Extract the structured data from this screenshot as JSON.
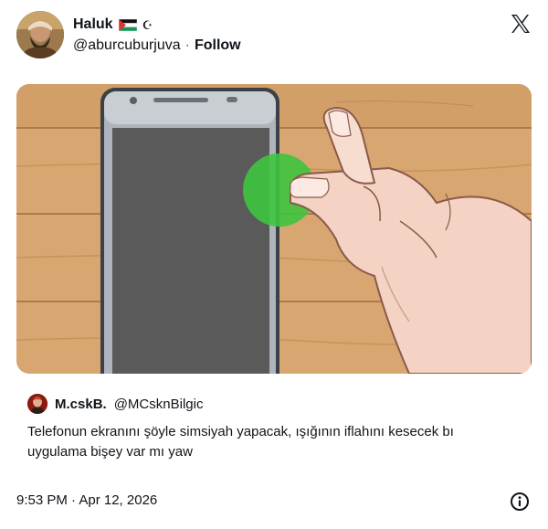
{
  "author": {
    "display_name": "Haluk",
    "flag_icon": "palestine-flag-icon",
    "crescent_icon": "crescent-star-icon",
    "crescent_glyph": "☪",
    "handle": "@aburcuburjuva",
    "separator": "·",
    "follow_label": "Follow"
  },
  "brand": {
    "logo_icon": "x-logo-icon"
  },
  "media": {
    "description_icon": "phone-tap-illustration",
    "highlight_color": "#3ec43e"
  },
  "quote": {
    "display_name": "M.cskB.",
    "handle": "@MCsknBilgic",
    "text": "Telefonun ekranını şöyle simsiyah yapacak, ışığının iflahını kesecek bı uygulama bişey var mı yaw"
  },
  "footer": {
    "timestamp": "9:53 PM · Apr 12, 2026",
    "info_icon": "info-icon"
  }
}
